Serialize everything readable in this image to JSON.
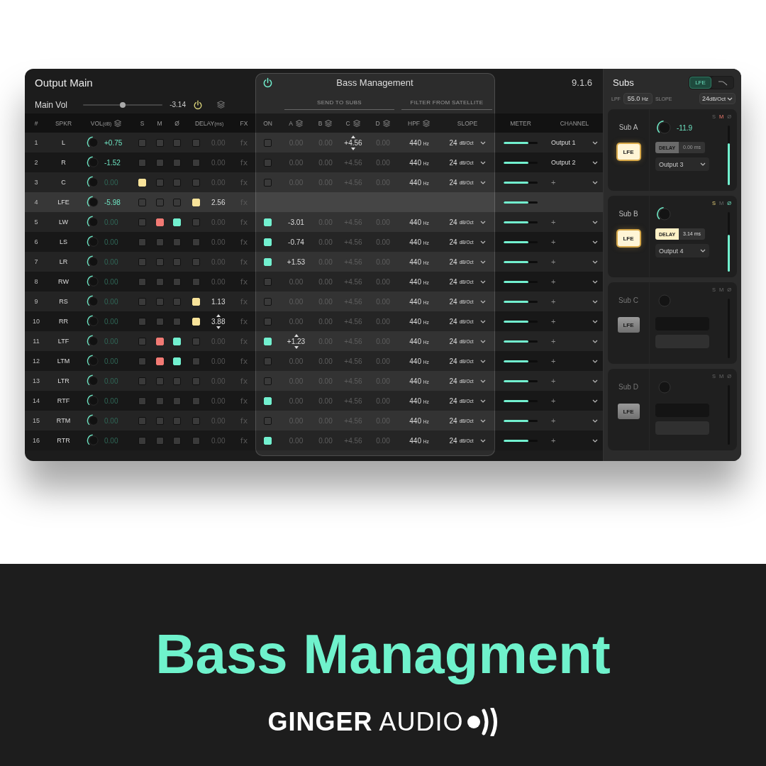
{
  "main": {
    "title": "Output Main",
    "version": "9.1.6",
    "main_vol": {
      "label": "Main Vol",
      "level": 0.5,
      "value": "-3.14"
    },
    "bass_management": {
      "title": "Bass Management",
      "enabled": true,
      "send_group": "SEND TO SUBS",
      "filter_group": "FILTER FROM SATELLITE"
    },
    "columns": [
      {
        "label": "#",
        "stack": false
      },
      {
        "label": "SPKR",
        "stack": false
      },
      {
        "label": "VOL",
        "unit": "(dB)",
        "stack": true
      },
      {
        "label": "S",
        "stack": false
      },
      {
        "label": "M",
        "stack": false
      },
      {
        "label": "Ø",
        "stack": false
      },
      {
        "label": "DELAY",
        "unit": "(ms)",
        "stack": false
      },
      {
        "label": "FX",
        "stack": false
      },
      {
        "label": "ON",
        "stack": false
      },
      {
        "label": "A",
        "stack": true
      },
      {
        "label": "B",
        "stack": true
      },
      {
        "label": "C",
        "stack": true
      },
      {
        "label": "D",
        "stack": true
      },
      {
        "label": "HPF",
        "stack": true
      },
      {
        "label": "SLOPE",
        "stack": false
      },
      {
        "label": "METER",
        "stack": false
      },
      {
        "label": "CHANNEL",
        "stack": false
      }
    ],
    "rows": [
      {
        "kind": "speaker",
        "num": "1",
        "spkr": "L",
        "vol": "+0.75",
        "vol_dim": false,
        "solo": false,
        "mute": false,
        "phase": false,
        "delay_on": false,
        "delay": "0.00",
        "delay_stepper": false,
        "fx": "fx",
        "on": false,
        "sends": [
          {
            "value": "0.00",
            "dim": true,
            "stepper": false
          },
          {
            "value": "0.00",
            "dim": true,
            "stepper": false
          },
          {
            "value": "+4.56",
            "dim": false,
            "stepper": true
          },
          {
            "value": "0.00",
            "dim": true,
            "stepper": false
          }
        ],
        "hpf": "440",
        "hpf_unit": "Hz",
        "slope": "24",
        "slope_unit": "dB/Oct",
        "level": 0.72,
        "channel": "Output 1",
        "channel_assigned": true
      },
      {
        "kind": "speaker",
        "num": "2",
        "spkr": "R",
        "vol": "-1.52",
        "vol_dim": false,
        "solo": false,
        "mute": false,
        "phase": false,
        "delay_on": false,
        "delay": "0.00",
        "delay_stepper": false,
        "fx": "fx",
        "on": false,
        "sends": [
          {
            "value": "0.00",
            "dim": true,
            "stepper": false
          },
          {
            "value": "0.00",
            "dim": true,
            "stepper": false
          },
          {
            "value": "+4.56",
            "dim": true,
            "stepper": false
          },
          {
            "value": "0.00",
            "dim": true,
            "stepper": false
          }
        ],
        "hpf": "440",
        "hpf_unit": "Hz",
        "slope": "24",
        "slope_unit": "dB/Oct",
        "level": 0.72,
        "channel": "Output 2",
        "channel_assigned": true
      },
      {
        "kind": "speaker",
        "num": "3",
        "spkr": "C",
        "vol": "0.00",
        "vol_dim": true,
        "solo": true,
        "mute": false,
        "phase": false,
        "delay_on": false,
        "delay": "0.00",
        "delay_stepper": false,
        "fx": "fx",
        "on": false,
        "sends": [
          {
            "value": "0.00",
            "dim": true,
            "stepper": false
          },
          {
            "value": "0.00",
            "dim": true,
            "stepper": false
          },
          {
            "value": "+4.56",
            "dim": true,
            "stepper": false
          },
          {
            "value": "0.00",
            "dim": true,
            "stepper": false
          }
        ],
        "hpf": "440",
        "hpf_unit": "Hz",
        "slope": "24",
        "slope_unit": "dB/Oct",
        "level": 0.72,
        "channel": "+",
        "channel_assigned": false
      },
      {
        "kind": "lfe",
        "num": "4",
        "spkr": "LFE",
        "vol": "-5.98",
        "vol_dim": false,
        "solo": false,
        "mute": false,
        "phase": false,
        "delay_on": true,
        "delay": "2.56",
        "delay_stepper": false,
        "fx": "fx",
        "level": 0.72
      },
      {
        "kind": "speaker",
        "num": "5",
        "spkr": "LW",
        "vol": "0.00",
        "vol_dim": true,
        "solo": false,
        "mute": true,
        "phase": true,
        "delay_on": false,
        "delay": "0.00",
        "delay_stepper": false,
        "fx": "fx",
        "on": true,
        "sends": [
          {
            "value": "-3.01",
            "dim": false,
            "stepper": false
          },
          {
            "value": "0.00",
            "dim": true,
            "stepper": false
          },
          {
            "value": "+4.56",
            "dim": true,
            "stepper": false
          },
          {
            "value": "0.00",
            "dim": true,
            "stepper": false
          }
        ],
        "hpf": "440",
        "hpf_unit": "Hz",
        "slope": "24",
        "slope_unit": "dB/Oct",
        "level": 0.72,
        "channel": "+",
        "channel_assigned": false
      },
      {
        "kind": "speaker",
        "num": "6",
        "spkr": "LS",
        "vol": "0.00",
        "vol_dim": true,
        "solo": false,
        "mute": false,
        "phase": false,
        "delay_on": false,
        "delay": "0.00",
        "delay_stepper": false,
        "fx": "fx",
        "on": true,
        "sends": [
          {
            "value": "-0.74",
            "dim": false,
            "stepper": false
          },
          {
            "value": "0.00",
            "dim": true,
            "stepper": false
          },
          {
            "value": "+4.56",
            "dim": true,
            "stepper": false
          },
          {
            "value": "0.00",
            "dim": true,
            "stepper": false
          }
        ],
        "hpf": "440",
        "hpf_unit": "Hz",
        "slope": "24",
        "slope_unit": "dB/Oct",
        "level": 0.72,
        "channel": "+",
        "channel_assigned": false
      },
      {
        "kind": "speaker",
        "num": "7",
        "spkr": "LR",
        "vol": "0.00",
        "vol_dim": true,
        "solo": false,
        "mute": false,
        "phase": false,
        "delay_on": false,
        "delay": "0.00",
        "delay_stepper": false,
        "fx": "fx",
        "on": true,
        "sends": [
          {
            "value": "+1.53",
            "dim": false,
            "stepper": false
          },
          {
            "value": "0.00",
            "dim": true,
            "stepper": false
          },
          {
            "value": "+4.56",
            "dim": true,
            "stepper": false
          },
          {
            "value": "0.00",
            "dim": true,
            "stepper": false
          }
        ],
        "hpf": "440",
        "hpf_unit": "Hz",
        "slope": "24",
        "slope_unit": "dB/Oct",
        "level": 0.72,
        "channel": "+",
        "channel_assigned": false
      },
      {
        "kind": "speaker",
        "num": "8",
        "spkr": "RW",
        "vol": "0.00",
        "vol_dim": true,
        "solo": false,
        "mute": false,
        "phase": false,
        "delay_on": false,
        "delay": "0.00",
        "delay_stepper": false,
        "fx": "fx",
        "on": false,
        "sends": [
          {
            "value": "0.00",
            "dim": true,
            "stepper": false
          },
          {
            "value": "0.00",
            "dim": true,
            "stepper": false
          },
          {
            "value": "+4.56",
            "dim": true,
            "stepper": false
          },
          {
            "value": "0.00",
            "dim": true,
            "stepper": false
          }
        ],
        "hpf": "440",
        "hpf_unit": "Hz",
        "slope": "24",
        "slope_unit": "dB/Oct",
        "level": 0.72,
        "channel": "+",
        "channel_assigned": false
      },
      {
        "kind": "speaker",
        "num": "9",
        "spkr": "RS",
        "vol": "0.00",
        "vol_dim": true,
        "solo": false,
        "mute": false,
        "phase": false,
        "delay_on": true,
        "delay": "1.13",
        "delay_stepper": false,
        "fx": "fx",
        "on": false,
        "sends": [
          {
            "value": "0.00",
            "dim": true,
            "stepper": false
          },
          {
            "value": "0.00",
            "dim": true,
            "stepper": false
          },
          {
            "value": "+4.56",
            "dim": true,
            "stepper": false
          },
          {
            "value": "0.00",
            "dim": true,
            "stepper": false
          }
        ],
        "hpf": "440",
        "hpf_unit": "Hz",
        "slope": "24",
        "slope_unit": "dB/Oct",
        "level": 0.72,
        "channel": "+",
        "channel_assigned": false
      },
      {
        "kind": "speaker",
        "num": "10",
        "spkr": "RR",
        "vol": "0.00",
        "vol_dim": true,
        "solo": false,
        "mute": false,
        "phase": false,
        "delay_on": true,
        "delay": "3.88",
        "delay_stepper": true,
        "fx": "fx",
        "on": false,
        "sends": [
          {
            "value": "0.00",
            "dim": true,
            "stepper": false
          },
          {
            "value": "0.00",
            "dim": true,
            "stepper": false
          },
          {
            "value": "+4.56",
            "dim": true,
            "stepper": false
          },
          {
            "value": "0.00",
            "dim": true,
            "stepper": false
          }
        ],
        "hpf": "440",
        "hpf_unit": "Hz",
        "slope": "24",
        "slope_unit": "dB/Oct",
        "level": 0.72,
        "channel": "+",
        "channel_assigned": false
      },
      {
        "kind": "speaker",
        "num": "11",
        "spkr": "LTF",
        "vol": "0.00",
        "vol_dim": true,
        "solo": false,
        "mute": true,
        "phase": true,
        "delay_on": false,
        "delay": "0.00",
        "delay_stepper": false,
        "fx": "fx",
        "on": true,
        "sends": [
          {
            "value": "+1.23",
            "dim": false,
            "stepper": true
          },
          {
            "value": "0.00",
            "dim": true,
            "stepper": false
          },
          {
            "value": "+4.56",
            "dim": true,
            "stepper": false
          },
          {
            "value": "0.00",
            "dim": true,
            "stepper": false
          }
        ],
        "hpf": "440",
        "hpf_unit": "Hz",
        "slope": "24",
        "slope_unit": "dB/Oct",
        "level": 0.72,
        "channel": "+",
        "channel_assigned": false
      },
      {
        "kind": "speaker",
        "num": "12",
        "spkr": "LTM",
        "vol": "0.00",
        "vol_dim": true,
        "solo": false,
        "mute": true,
        "phase": true,
        "delay_on": false,
        "delay": "0.00",
        "delay_stepper": false,
        "fx": "fx",
        "on": false,
        "sends": [
          {
            "value": "0.00",
            "dim": true,
            "stepper": false
          },
          {
            "value": "0.00",
            "dim": true,
            "stepper": false
          },
          {
            "value": "+4.56",
            "dim": true,
            "stepper": false
          },
          {
            "value": "0.00",
            "dim": true,
            "stepper": false
          }
        ],
        "hpf": "440",
        "hpf_unit": "Hz",
        "slope": "24",
        "slope_unit": "dB/Oct",
        "level": 0.72,
        "channel": "+",
        "channel_assigned": false
      },
      {
        "kind": "speaker",
        "num": "13",
        "spkr": "LTR",
        "vol": "0.00",
        "vol_dim": true,
        "solo": false,
        "mute": false,
        "phase": false,
        "delay_on": false,
        "delay": "0.00",
        "delay_stepper": false,
        "fx": "fx",
        "on": false,
        "sends": [
          {
            "value": "0.00",
            "dim": true,
            "stepper": false
          },
          {
            "value": "0.00",
            "dim": true,
            "stepper": false
          },
          {
            "value": "+4.56",
            "dim": true,
            "stepper": false
          },
          {
            "value": "0.00",
            "dim": true,
            "stepper": false
          }
        ],
        "hpf": "440",
        "hpf_unit": "Hz",
        "slope": "24",
        "slope_unit": "dB/Oct",
        "level": 0.72,
        "channel": "+",
        "channel_assigned": false
      },
      {
        "kind": "speaker",
        "num": "14",
        "spkr": "RTF",
        "vol": "0.00",
        "vol_dim": true,
        "solo": false,
        "mute": false,
        "phase": false,
        "delay_on": false,
        "delay": "0.00",
        "delay_stepper": false,
        "fx": "fx",
        "on": true,
        "sends": [
          {
            "value": "0.00",
            "dim": true,
            "stepper": false
          },
          {
            "value": "0.00",
            "dim": true,
            "stepper": false
          },
          {
            "value": "+4.56",
            "dim": true,
            "stepper": false
          },
          {
            "value": "0.00",
            "dim": true,
            "stepper": false
          }
        ],
        "hpf": "440",
        "hpf_unit": "Hz",
        "slope": "24",
        "slope_unit": "dB/Oct",
        "level": 0.72,
        "channel": "+",
        "channel_assigned": false
      },
      {
        "kind": "speaker",
        "num": "15",
        "spkr": "RTM",
        "vol": "0.00",
        "vol_dim": true,
        "solo": false,
        "mute": false,
        "phase": false,
        "delay_on": false,
        "delay": "0.00",
        "delay_stepper": false,
        "fx": "fx",
        "on": false,
        "sends": [
          {
            "value": "0.00",
            "dim": true,
            "stepper": false
          },
          {
            "value": "0.00",
            "dim": true,
            "stepper": false
          },
          {
            "value": "+4.56",
            "dim": true,
            "stepper": false
          },
          {
            "value": "0.00",
            "dim": true,
            "stepper": false
          }
        ],
        "hpf": "440",
        "hpf_unit": "Hz",
        "slope": "24",
        "slope_unit": "dB/Oct",
        "level": 0.72,
        "channel": "+",
        "channel_assigned": false
      },
      {
        "kind": "speaker",
        "num": "16",
        "spkr": "RTR",
        "vol": "0.00",
        "vol_dim": true,
        "solo": false,
        "mute": false,
        "phase": false,
        "delay_on": false,
        "delay": "0.00",
        "delay_stepper": false,
        "fx": "fx",
        "on": true,
        "sends": [
          {
            "value": "0.00",
            "dim": true,
            "stepper": false
          },
          {
            "value": "0.00",
            "dim": true,
            "stepper": false
          },
          {
            "value": "+4.56",
            "dim": true,
            "stepper": false
          },
          {
            "value": "0.00",
            "dim": true,
            "stepper": false
          }
        ],
        "hpf": "440",
        "hpf_unit": "Hz",
        "slope": "24",
        "slope_unit": "dB/Oct",
        "level": 0.72,
        "channel": "+",
        "channel_assigned": false
      }
    ]
  },
  "subs": {
    "title": "Subs",
    "modes": [
      {
        "kind": "lfe",
        "label": "LFE",
        "selected": true
      },
      {
        "kind": "curve",
        "selected": false
      }
    ],
    "lpf_label": "LPF",
    "lpf": "55.0",
    "lpf_unit": "Hz",
    "slope_label": "SLOPE",
    "slope": "24",
    "slope_unit": "dB/Oct",
    "cards": [
      {
        "kind": "assigned",
        "name": "Sub A",
        "lfe_label": "LFE",
        "lfe": true,
        "value": "-11.9",
        "flags": [
          {
            "kind": "solo",
            "label": "S",
            "on": false
          },
          {
            "kind": "mute",
            "label": "M",
            "on": true
          },
          {
            "kind": "phase",
            "label": "Ø",
            "on": false
          }
        ],
        "delay_label": "DELAY",
        "delay_on": false,
        "delay": "0.00 ms",
        "output": "Output 3",
        "level": 0.7
      },
      {
        "kind": "assigned",
        "name": "Sub B",
        "lfe_label": "LFE",
        "lfe": true,
        "flags": [
          {
            "kind": "solo",
            "label": "S",
            "on": true
          },
          {
            "kind": "mute",
            "label": "M",
            "on": false
          },
          {
            "kind": "phase",
            "label": "Ø",
            "on": true
          }
        ],
        "delay_label": "DELAY",
        "delay_on": true,
        "delay": "3.14 ms",
        "output": "Output 4",
        "level": 0.62
      },
      {
        "kind": "empty",
        "name": "Sub C",
        "lfe_label": "LFE",
        "lfe": false,
        "flags": [
          {
            "kind": "solo",
            "label": "S",
            "on": false
          },
          {
            "kind": "mute",
            "label": "M",
            "on": false
          },
          {
            "kind": "phase",
            "label": "Ø",
            "on": false
          }
        ]
      },
      {
        "kind": "empty",
        "name": "Sub D",
        "lfe_label": "LFE",
        "lfe": false,
        "flags": [
          {
            "kind": "solo",
            "label": "S",
            "on": false
          },
          {
            "kind": "mute",
            "label": "M",
            "on": false
          },
          {
            "kind": "phase",
            "label": "Ø",
            "on": false
          }
        ]
      }
    ]
  },
  "banner": {
    "title": "Bass Managment",
    "logo": "**GINGER** AUDIO"
  }
}
